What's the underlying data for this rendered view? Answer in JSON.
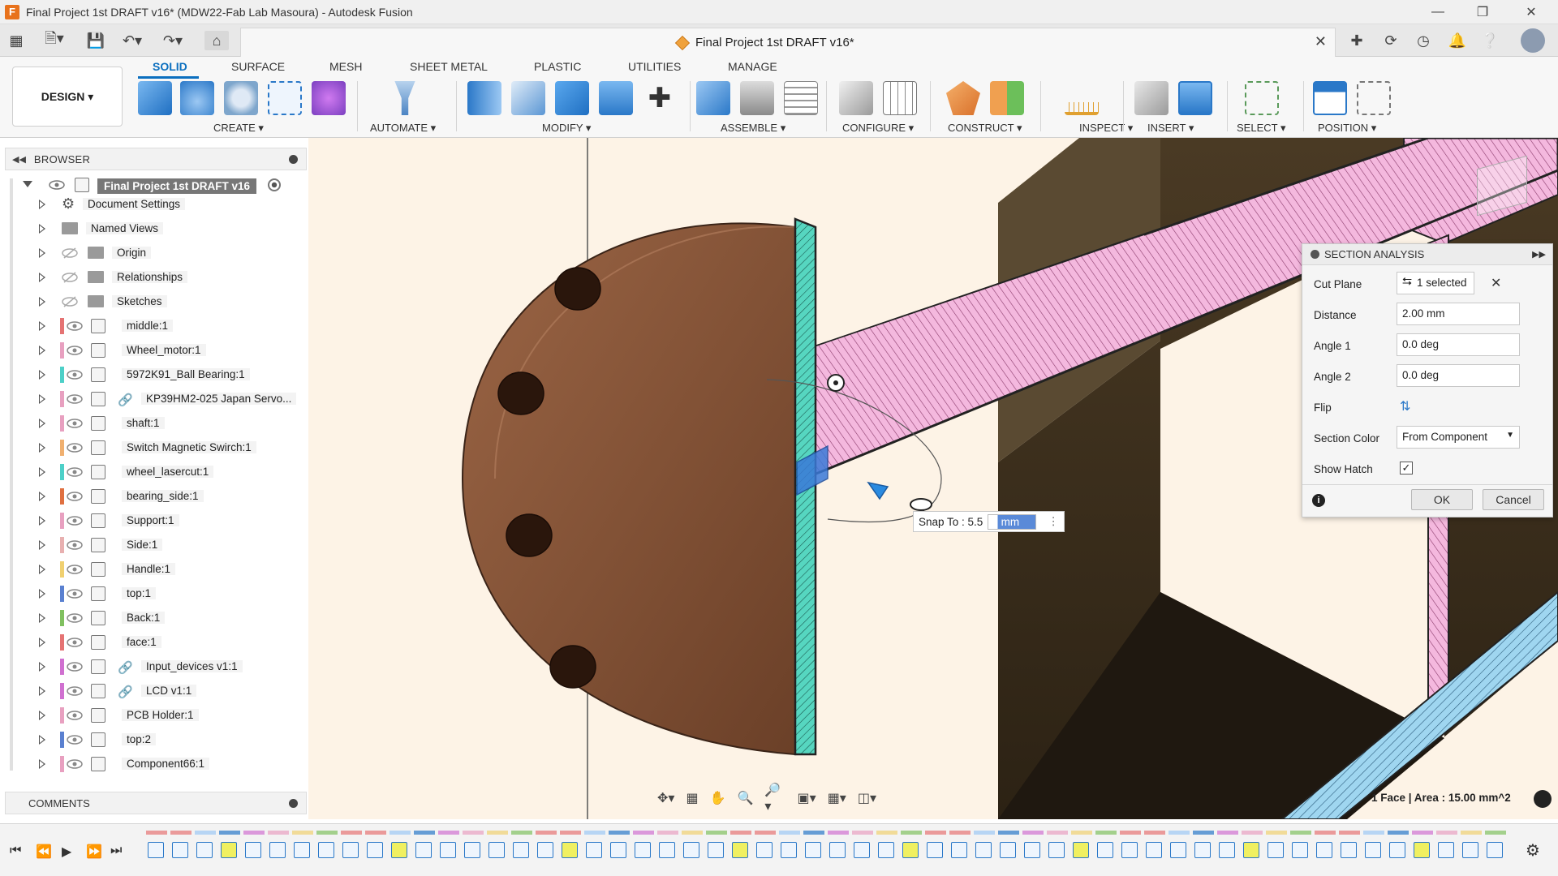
{
  "window": {
    "title": "Final Project 1st DRAFT v16* (MDW22-Fab Lab Masoura) - Autodesk Fusion"
  },
  "document_tab": {
    "title": "Final Project 1st DRAFT v16*"
  },
  "workspace": {
    "design_label": "DESIGN ▾"
  },
  "ribbon": {
    "tabs": [
      "SOLID",
      "SURFACE",
      "MESH",
      "SHEET METAL",
      "PLASTIC",
      "UTILITIES",
      "MANAGE"
    ],
    "active_tab": "SOLID",
    "groups": [
      "CREATE ▾",
      "AUTOMATE ▾",
      "MODIFY ▾",
      "ASSEMBLE ▾",
      "CONFIGURE ▾",
      "CONSTRUCT ▾",
      "INSPECT ▾",
      "INSERT ▾",
      "SELECT ▾",
      "POSITION ▾"
    ]
  },
  "browser": {
    "header": "BROWSER",
    "root": "Final Project 1st DRAFT v16",
    "items": [
      {
        "label": "Document Settings",
        "kind": "settings",
        "color": ""
      },
      {
        "label": "Named Views",
        "kind": "folder",
        "color": ""
      },
      {
        "label": "Origin",
        "kind": "folder-hidden",
        "color": ""
      },
      {
        "label": "Relationships",
        "kind": "folder-hidden",
        "color": ""
      },
      {
        "label": "Sketches",
        "kind": "folder-hidden",
        "color": ""
      },
      {
        "label": "middle:1",
        "kind": "comp",
        "color": "#e57373"
      },
      {
        "label": "Wheel_motor:1",
        "kind": "comp",
        "color": "#e8a0c0"
      },
      {
        "label": "5972K91_Ball Bearing:1",
        "kind": "comp",
        "color": "#4dd0c8"
      },
      {
        "label": "KP39HM2-025 Japan Servo...",
        "kind": "link",
        "color": "#e8a0c0"
      },
      {
        "label": "shaft:1",
        "kind": "comp",
        "color": "#e8a0c0"
      },
      {
        "label": "Switch Magnetic Swirch:1",
        "kind": "comp",
        "color": "#f0b070"
      },
      {
        "label": "wheel_lasercut:1",
        "kind": "comp",
        "color": "#4dd0c8"
      },
      {
        "label": "bearing_side:1",
        "kind": "comp",
        "color": "#e07040"
      },
      {
        "label": "Support:1",
        "kind": "comp",
        "color": "#e8a0c0"
      },
      {
        "label": "Side:1",
        "kind": "comp",
        "color": "#e8b0b0"
      },
      {
        "label": "Handle:1",
        "kind": "comp",
        "color": "#f0d070"
      },
      {
        "label": "top:1",
        "kind": "comp",
        "color": "#5a80d0"
      },
      {
        "label": "Back:1",
        "kind": "comp",
        "color": "#80c060"
      },
      {
        "label": "face:1",
        "kind": "comp",
        "color": "#e57373"
      },
      {
        "label": "Input_devices v1:1",
        "kind": "link",
        "color": "#d070d0"
      },
      {
        "label": "LCD v1:1",
        "kind": "link",
        "color": "#d070d0"
      },
      {
        "label": "PCB Holder:1",
        "kind": "comp",
        "color": "#e8a0c0"
      },
      {
        "label": "top:2",
        "kind": "comp",
        "color": "#5a80d0"
      },
      {
        "label": "Component66:1",
        "kind": "comp",
        "color": "#e8a0c0"
      }
    ]
  },
  "section_analysis": {
    "title": "SECTION ANALYSIS",
    "cut_plane_label": "Cut Plane",
    "cut_plane_value": "1 selected",
    "distance_label": "Distance",
    "distance_value": "2.00 mm",
    "angle1_label": "Angle 1",
    "angle1_value": "0.0 deg",
    "angle2_label": "Angle 2",
    "angle2_value": "0.0 deg",
    "flip_label": "Flip",
    "section_color_label": "Section Color",
    "section_color_value": "From Component",
    "show_hatch_label": "Show Hatch",
    "show_hatch_checked": true,
    "ok_label": "OK",
    "cancel_label": "Cancel"
  },
  "viewport": {
    "snap_label": "Snap To : 5.5",
    "snap_input": "0 mm",
    "status": "1 Face | Area : 15.00 mm^2"
  },
  "comments": {
    "header": "COMMENTS"
  },
  "colors": {
    "accent": "#0b6fbf",
    "viewport_bg": "#fdf3e6",
    "section_pink": "#f4b8de",
    "wheel_brown": "#8a5a3c",
    "bearing_cyan": "#56d6c0"
  }
}
